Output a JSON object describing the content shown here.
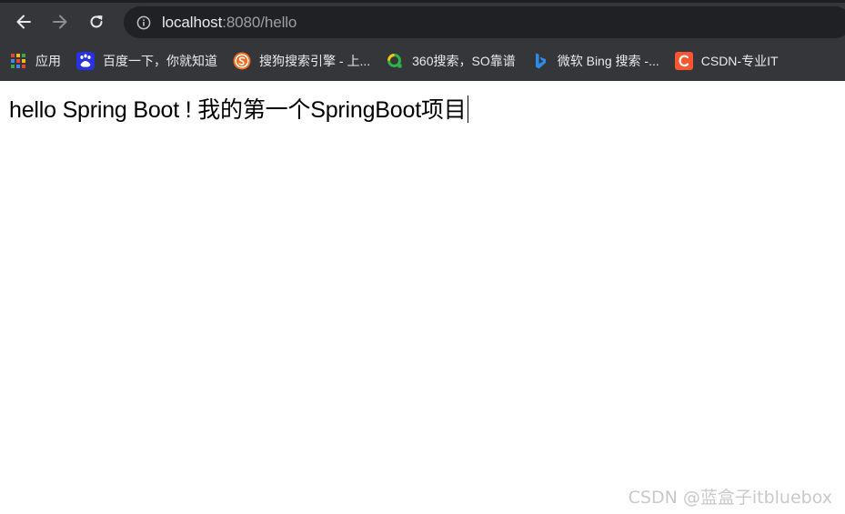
{
  "browser": {
    "url_host": "localhost",
    "url_rest": ":8080/hello"
  },
  "bookmarks": [
    {
      "label": "应用",
      "icon": "apps-grid-icon"
    },
    {
      "label": "百度一下，你就知道",
      "icon": "baidu-icon"
    },
    {
      "label": "搜狗搜索引擎 - 上...",
      "icon": "sogou-icon"
    },
    {
      "label": "360搜索，SO靠谱",
      "icon": "360-search-icon"
    },
    {
      "label": "微软 Bing 搜索 -...",
      "icon": "bing-icon"
    },
    {
      "label": "CSDN-专业IT",
      "icon": "csdn-icon"
    }
  ],
  "page": {
    "text": "hello Spring Boot ! 我的第一个SpringBoot项目"
  },
  "watermark": "CSDN @蓝盒子itbluebox",
  "colors": {
    "chrome_frame": "#35363a",
    "omnibox": "#202124",
    "sogou": "#f26b1d",
    "baidu": "#2932e1",
    "bing": "#2a8de8",
    "csdn": "#fc5531",
    "so360": "#2cb34a"
  }
}
